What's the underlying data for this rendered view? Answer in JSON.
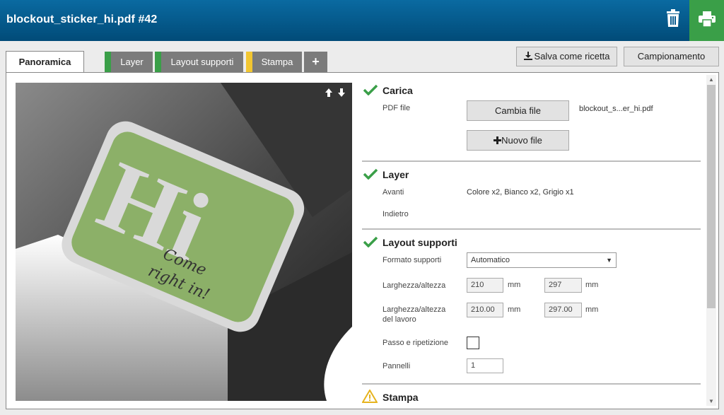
{
  "header": {
    "title": "blockout_sticker_hi.pdf #42",
    "trash_icon": "trash-icon",
    "print_icon": "printer-icon",
    "accent": "#3a9f48"
  },
  "tabs": [
    {
      "label": "Panoramica",
      "active": true
    },
    {
      "label": "Layer",
      "color": "#3a9f48"
    },
    {
      "label": "Layout supporti",
      "color": "#3a9f48"
    },
    {
      "label": "Stampa",
      "color": "#f2c631"
    },
    {
      "label": "+"
    }
  ],
  "toolbar": {
    "save_recipe": "Salva come ricetta",
    "sampling": "Campionamento"
  },
  "preview": {
    "sticker_big": "Hi",
    "sticker_line1": "Come",
    "sticker_line2": "right in!",
    "arrows": "🡅🡇"
  },
  "sections": {
    "carica": {
      "title": "Carica",
      "status": "ok",
      "pdf_label": "PDF file",
      "change_file": "Cambia file",
      "new_file": "Nuovo file",
      "file_name": "blockout_s...er_hi.pdf"
    },
    "layer": {
      "title": "Layer",
      "status": "ok",
      "front_label": "Avanti",
      "front_value": "Colore x2, Bianco x2, Grigio x1",
      "back_label": "Indietro"
    },
    "layout": {
      "title": "Layout supporti",
      "status": "ok",
      "media_format_label": "Formato supporti",
      "media_format_value": "Automatico",
      "wh_label": "Larghezza/altezza",
      "width": "210",
      "height": "297",
      "unit": "mm",
      "job_wh_label_1": "Larghezza/altezza",
      "job_wh_label_2": "del lavoro",
      "job_width": "210.00",
      "job_height": "297.00",
      "step_repeat_label": "Passo e ripetizione",
      "panels_label": "Pannelli",
      "panels_value": "1"
    },
    "stampa": {
      "title": "Stampa",
      "status": "warning"
    }
  }
}
